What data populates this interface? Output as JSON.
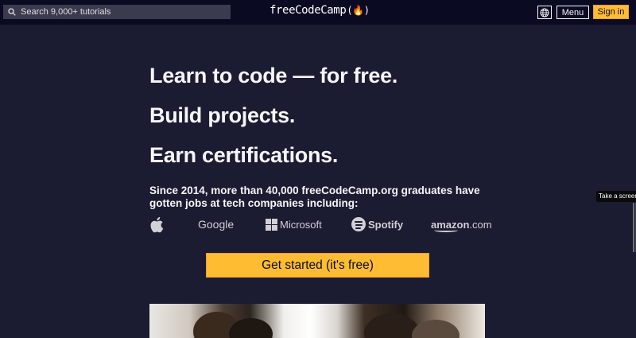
{
  "navbar": {
    "search_placeholder": "Search 9,000+ tutorials",
    "logo_text": "freeCodeCamp",
    "logo_flame": "(🔥)",
    "menu_label": "Menu",
    "signin_label": "Sign in"
  },
  "hero": {
    "headline_1": "Learn to code — for free.",
    "headline_2": "Build projects.",
    "headline_3": "Earn certifications.",
    "subtext": "Since 2014, more than 40,000 freeCodeCamp.org graduates have gotten jobs at tech companies including:",
    "companies": {
      "google": "Google",
      "microsoft": "Microsoft",
      "spotify": "Spotify",
      "amazon_main": "amazon",
      "amazon_tld": ".com"
    },
    "cta_label": "Get started (it's free)"
  },
  "overlay": {
    "tooltip": "Take a screenshot"
  },
  "colors": {
    "background": "#1b1b32",
    "navbar": "#0a0a23",
    "accent": "#febc33",
    "search_bg": "#3b3b4f"
  }
}
